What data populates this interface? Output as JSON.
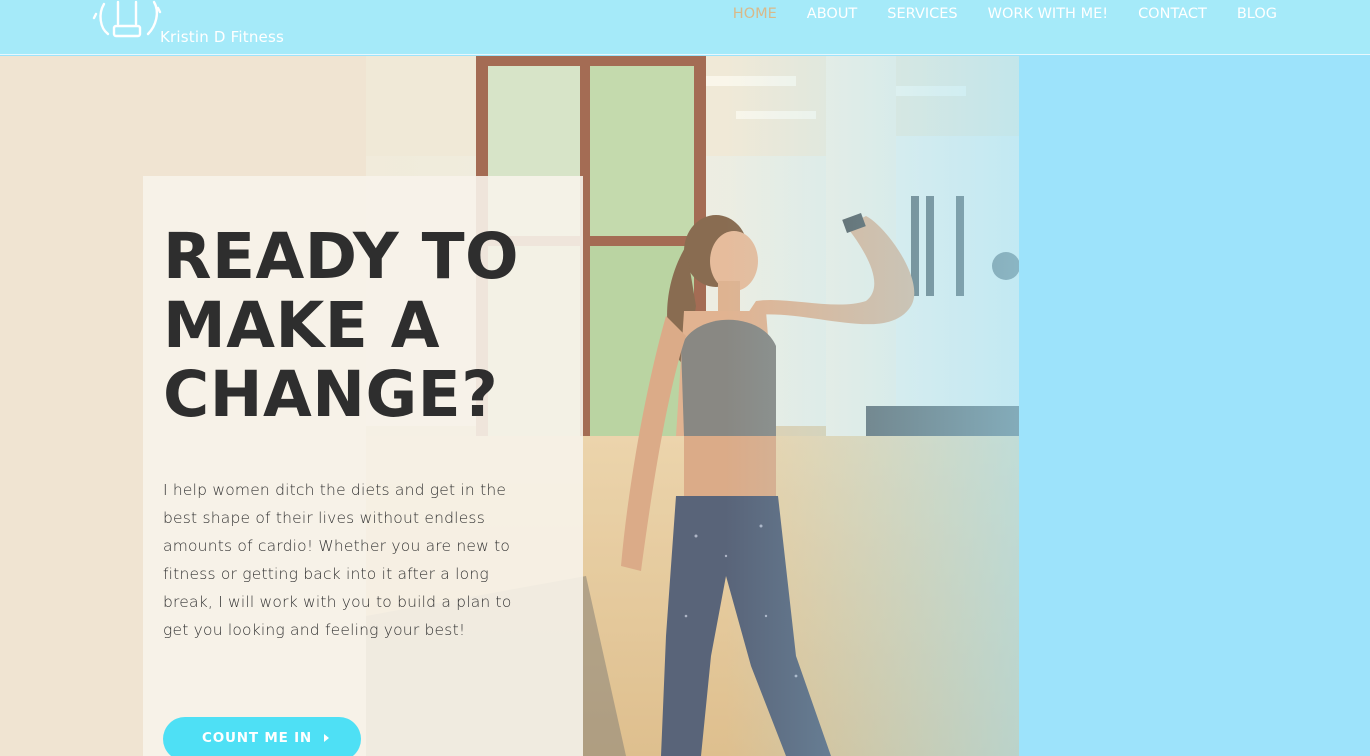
{
  "site": {
    "brand": "Kristin D Fitness",
    "logo_icon": "dumbbell-person-icon"
  },
  "nav": {
    "items": [
      {
        "label": "HOME",
        "active": true
      },
      {
        "label": "ABOUT",
        "active": false
      },
      {
        "label": "SERVICES",
        "active": false
      },
      {
        "label": "WORK WITH ME!",
        "active": false
      },
      {
        "label": "CONTACT",
        "active": false
      },
      {
        "label": "BLOG",
        "active": false
      }
    ]
  },
  "hero": {
    "headline_lines": [
      "READY TO",
      "MAKE A",
      "CHANGE?"
    ],
    "intro": "I help women ditch the diets and get in the best shape of their lives without endless amounts of cardio! Whether you are new to fitness or getting back into it after a long break, I will work with you to build a plan to get you looking and feeling your best!",
    "cta_label": "COUNT ME IN",
    "cta_icon": "caret-right-icon"
  },
  "colors": {
    "header_bg": "#a5eaf9",
    "nav_active": "#d9b98a",
    "beige_panel": "#f0e4d2",
    "blue_panel": "#9de3fb",
    "cta_bg": "#4ee0f5",
    "headline": "#2e2e2e"
  }
}
